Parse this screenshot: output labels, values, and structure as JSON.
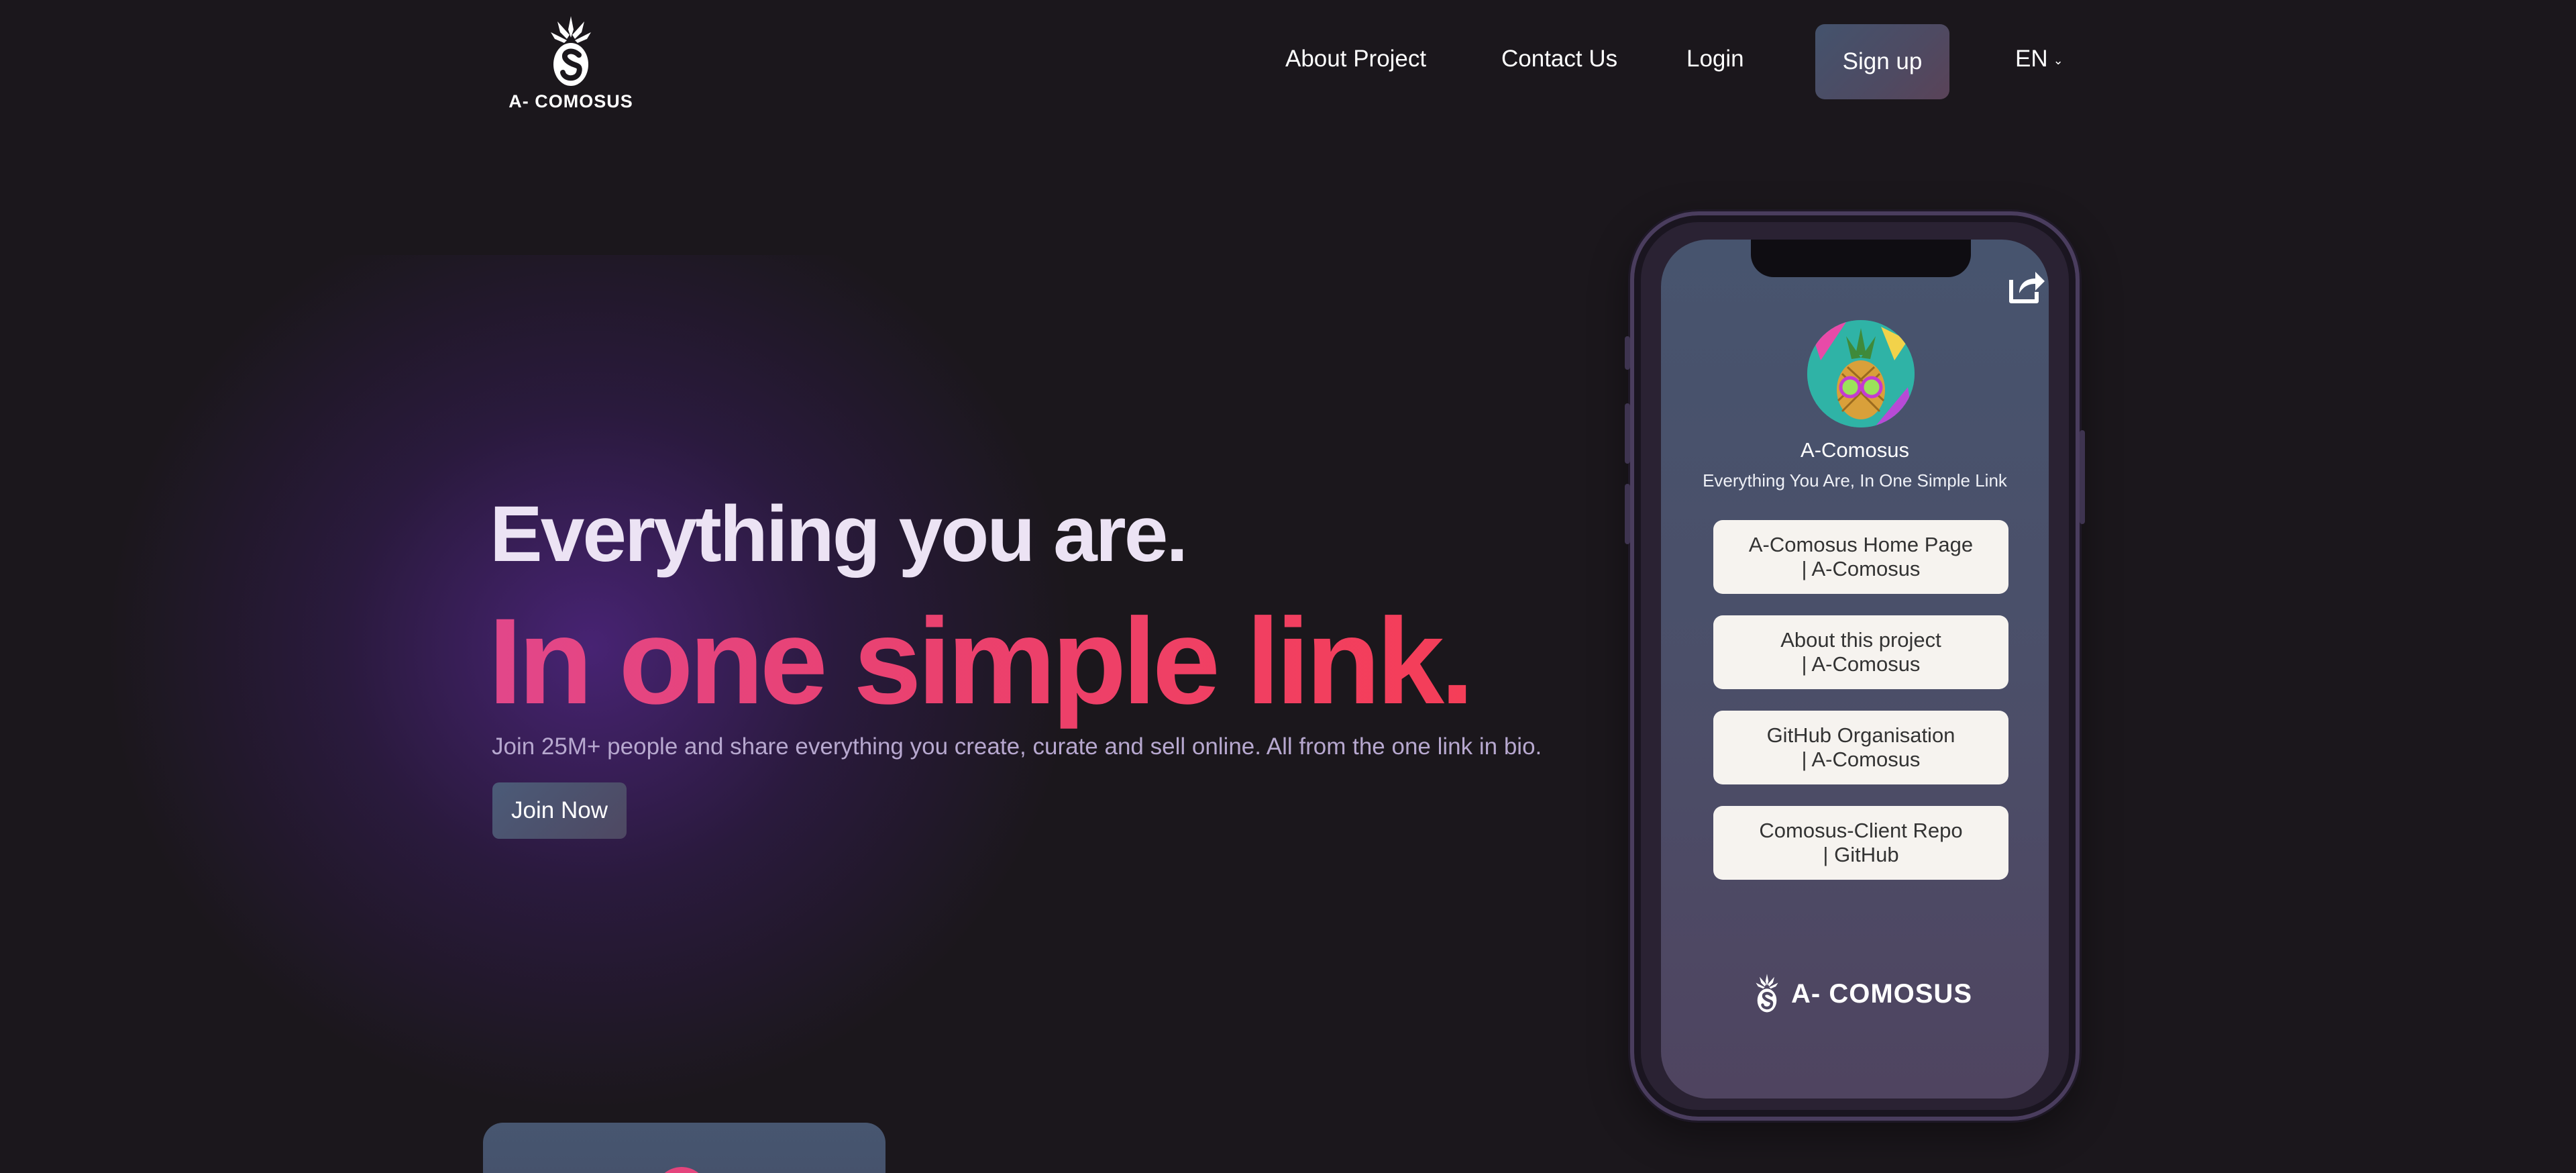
{
  "brand": {
    "name": "A- COMOSUS"
  },
  "nav": {
    "about": "About Project",
    "contact": "Contact Us",
    "login": "Login",
    "signup": "Sign up",
    "language": "EN"
  },
  "hero": {
    "title": "Everything you are.",
    "subtitle": "In one simple link.",
    "description": "Join 25M+ people and share everything you create, curate and sell online. All from the one link in bio.",
    "cta": "Join Now"
  },
  "phone": {
    "profile_name": "A-Comosus",
    "tagline": "Everything You Are, In One Simple Link",
    "links": [
      {
        "line1": "A-Comosus Home Page",
        "line2": "| A-Comosus"
      },
      {
        "line1": "About this project",
        "line2": "| A-Comosus"
      },
      {
        "line1": "GitHub Organisation",
        "line2": "| A-Comosus"
      },
      {
        "line1": "Comosus-Client Repo",
        "line2": "| GitHub"
      }
    ],
    "footer_brand": "A- COMOSUS"
  },
  "colors": {
    "background": "#1b171c",
    "accent_pink": "#ea416f",
    "button_slate": "#4b5b78",
    "link_card": "#f6f3ef"
  },
  "icons": [
    "pineapple-logo-icon",
    "chevron-down-icon",
    "share-icon"
  ]
}
